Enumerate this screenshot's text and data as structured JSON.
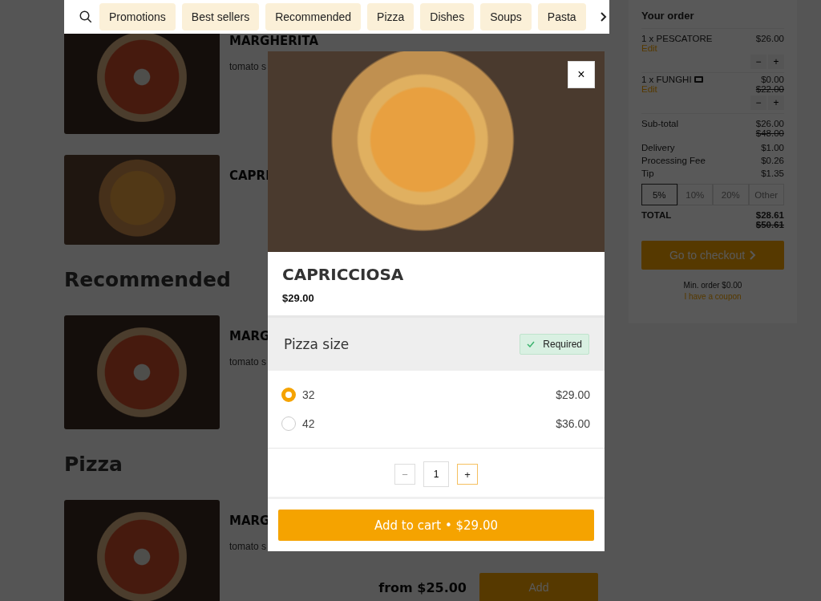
{
  "nav": {
    "chips": [
      {
        "label": "Promotions"
      },
      {
        "label": "Best sellers"
      },
      {
        "label": "Recommended"
      },
      {
        "label": "Pizza"
      },
      {
        "label": "Dishes"
      },
      {
        "label": "Soups"
      },
      {
        "label": "Pasta"
      }
    ]
  },
  "menu": [
    {
      "kind": "dish",
      "title": "MARGHERITA",
      "description": "tomato s"
    },
    {
      "kind": "compact-dish",
      "title": "CAPRI"
    },
    {
      "kind": "heading",
      "title": "Recommended"
    },
    {
      "kind": "dish",
      "title": "MARG",
      "description": "tomato s"
    },
    {
      "kind": "heading",
      "title": "Pizza"
    },
    {
      "kind": "dish",
      "title": "MARG",
      "description": "tomato s",
      "price": "from $25.00",
      "button": "Add"
    }
  ],
  "order": {
    "title": "Your order",
    "items": [
      {
        "name": "1 x PESCATORE",
        "price": "$26.00",
        "edit": "Edit",
        "voucher": false,
        "minus": "−",
        "plus": "+"
      },
      {
        "name": "1 x FUNGHI",
        "price": "$0.00",
        "old_price": "$22.00",
        "edit": "Edit",
        "voucher": true,
        "minus": "−",
        "plus": "+"
      }
    ],
    "subtotal": {
      "label": "Sub-total",
      "value": "$26.00",
      "old_value": "$48.00"
    },
    "fees": [
      {
        "label": "Delivery",
        "value": "$1.00"
      },
      {
        "label": "Processing Fee",
        "value": "$0.26"
      },
      {
        "label": "Tip",
        "value": "$1.35"
      }
    ],
    "tips": [
      {
        "label": "5%",
        "selected": true
      },
      {
        "label": "10%",
        "selected": false
      },
      {
        "label": "20%",
        "selected": false
      },
      {
        "label": "Other",
        "selected": false
      }
    ],
    "total": {
      "label": "TOTAL",
      "value": "$28.61",
      "old_value": "$50.61"
    },
    "checkout": "Go to checkout",
    "min_order": "Min. order $0.00",
    "coupon": "I have a coupon"
  },
  "modal": {
    "close": "×",
    "title": "CAPRICCIOSA",
    "price": "$29.00",
    "group": {
      "title": "Pizza size",
      "badge": "Required"
    },
    "options": [
      {
        "label": "32",
        "price": "$29.00",
        "selected": true
      },
      {
        "label": "42",
        "price": "$36.00",
        "selected": false
      }
    ],
    "quantity": "1",
    "minus": "−",
    "plus": "+",
    "add_button": "Add to cart • $29.00"
  }
}
